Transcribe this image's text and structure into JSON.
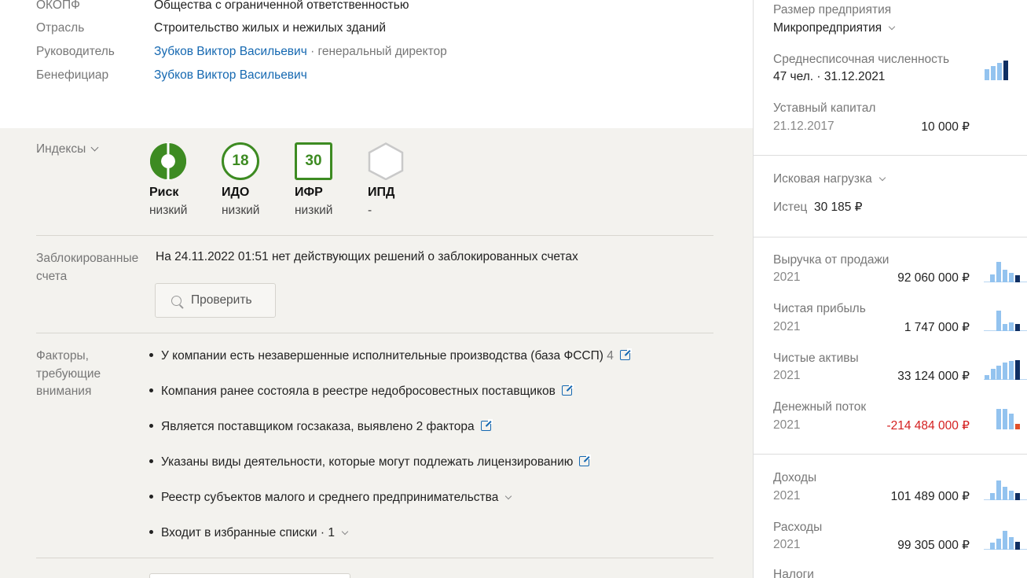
{
  "colors": {
    "link": "#1568b1",
    "green": "#3d8b22",
    "negative": "#d42020",
    "bar_light": "#93c3ef",
    "bar_dark": "#0f2f63",
    "bar_red": "#e0502a"
  },
  "company": {
    "okopf_label": "ОКОПФ",
    "okopf_value": "Общества с ограниченной ответственностью",
    "industry_label": "Отрасль",
    "industry_value": "Строительство жилых и нежилых зданий",
    "head_label": "Руководитель",
    "head_name": "Зубков Виктор Васильевич",
    "head_role": " · генеральный директор",
    "beneficiary_label": "Бенефициар",
    "beneficiary_name": "Зубков Виктор Васильевич"
  },
  "indexes": {
    "title": "Индексы",
    "items": [
      {
        "name": "Риск",
        "level": "низкий",
        "icon": "risk-pie-icon"
      },
      {
        "name": "ИДО",
        "value": "18",
        "level": "низкий"
      },
      {
        "name": "ИФР",
        "value": "30",
        "level": "низкий"
      },
      {
        "name": "ИПД",
        "value": "",
        "level": "-"
      }
    ]
  },
  "blocked": {
    "label_line1": "Заблокированные",
    "label_line2": "счета",
    "text": "На 24.11.2022 01:51 нет действующих решений о заблокированных счетах",
    "check_button": "Проверить"
  },
  "factors": {
    "label_line1": "Факторы,",
    "label_line2": "требующие",
    "label_line3": "внимания",
    "items": [
      {
        "text": "У компании есть незавершенные исполнительные производства (база ФССП)",
        "count": " 4"
      },
      {
        "text": "Компания ранее состояла в реестре недобросовестных поставщиков"
      },
      {
        "text": "Является поставщиком госзаказа, выявлено 2 фактора"
      },
      {
        "text": "Указаны виды деятельности, которые могут подлежать лицензированию"
      },
      {
        "text": "Реестр субъектов малого и среднего предпринимательства"
      },
      {
        "text": "Входит в избранные списки · 1"
      }
    ]
  },
  "right": {
    "size_label": "Размер предприятия",
    "size_value": "Микропредприятия",
    "headcount_label": "Среднесписочная численность",
    "headcount_value": "47 чел. · 31.12.2021",
    "capital_label": "Уставный капитал",
    "capital_date": "21.12.2017",
    "capital_value": "10 000 ₽",
    "lawsuit_label": "Исковая нагрузка",
    "plaintiff_label": "Истец",
    "plaintiff_value": "30 185 ₽",
    "finance": [
      {
        "label": "Выручка от продажи",
        "year": "2021",
        "value": "92 060 000 ₽"
      },
      {
        "label": "Чистая прибыль",
        "year": "2021",
        "value": "1 747 000 ₽"
      },
      {
        "label": "Чистые активы",
        "year": "2021",
        "value": "33 124 000 ₽"
      },
      {
        "label": "Денежный поток",
        "year": "2021",
        "value": "-214 484 000 ₽"
      }
    ],
    "finance2": [
      {
        "label": "Доходы",
        "year": "2021",
        "value": "101 489 000 ₽"
      },
      {
        "label": "Расходы",
        "year": "2021",
        "value": "99 305 000 ₽"
      }
    ],
    "taxes_label": "Налоги"
  }
}
